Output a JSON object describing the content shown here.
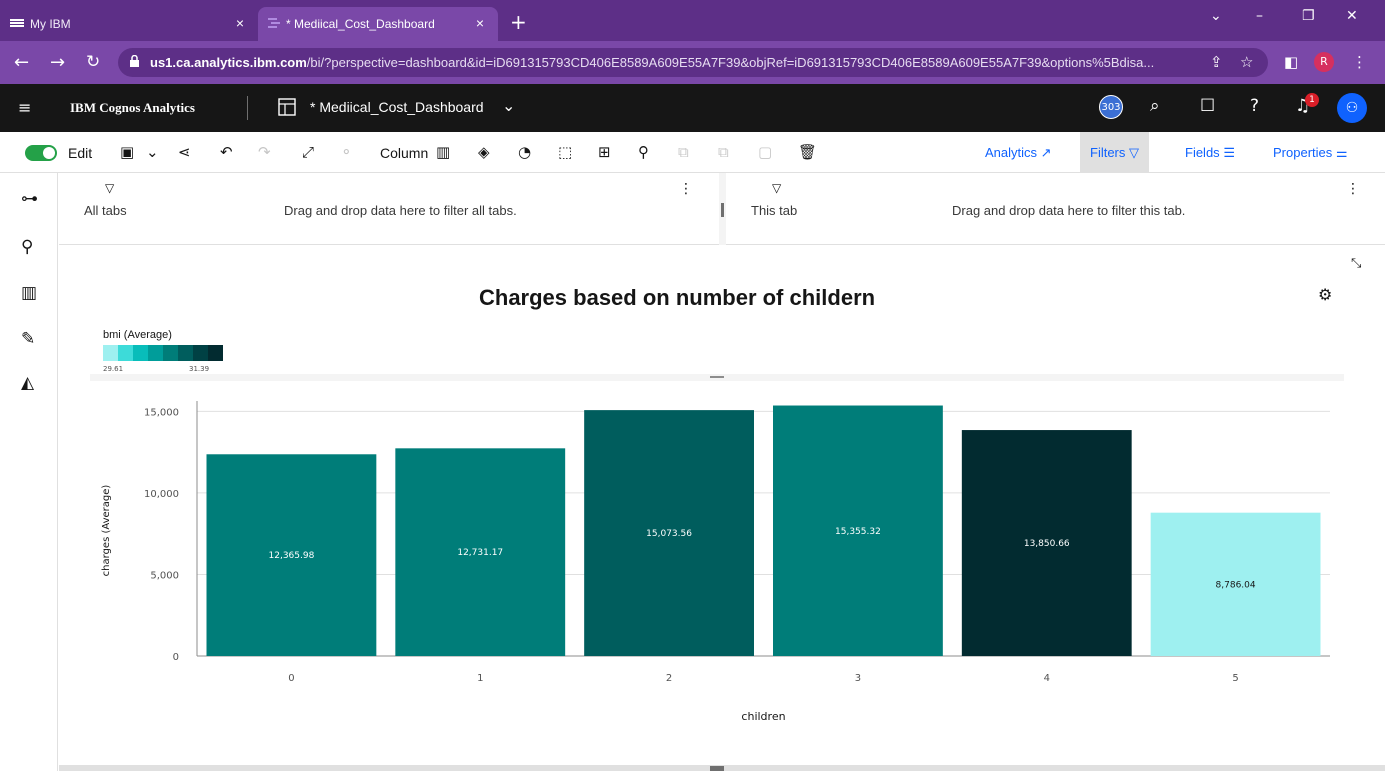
{
  "browser": {
    "tabs": [
      {
        "label": "My IBM",
        "close": "×"
      },
      {
        "label": "* Mediical_Cost_Dashboard",
        "close": "×"
      }
    ],
    "new_tab": "+",
    "url_host": "us1.ca.analytics.ibm.com",
    "url_path": "/bi/?perspective=dashboard&id=iD691315793CD406E8589A609E55A7F39&objRef=iD691315793CD406E8589A609E55A7F39&options%5Bdisa...",
    "profile_initial": "R"
  },
  "app": {
    "name": "IBM Cognos Analytics",
    "dashboard_title": "* Mediical_Cost_Dashboard",
    "count_badge": "303",
    "notification_count": "1"
  },
  "toolbar": {
    "edit_label": "Edit",
    "column_label": "Column",
    "panel_tabs": [
      {
        "label": "Analytics",
        "active": false
      },
      {
        "label": "Filters",
        "active": true
      },
      {
        "label": "Fields",
        "active": false
      },
      {
        "label": "Properties",
        "active": false
      }
    ]
  },
  "filters": {
    "all_tabs_label": "All tabs",
    "all_tabs_hint": "Drag and drop data here to filter all tabs.",
    "this_tab_label": "This tab",
    "this_tab_hint": "Drag and drop data here to filter this tab."
  },
  "legend": {
    "title": "bmi (Average)",
    "min": "29.61",
    "max": "31.39",
    "colors": [
      "#9ef0f0",
      "#3ddbd9",
      "#08bdba",
      "#009d9a",
      "#007d79",
      "#005d5d",
      "#004144",
      "#022b30"
    ]
  },
  "chart_data": {
    "type": "bar",
    "title": "Charges based on number of childern",
    "xlabel": "children",
    "ylabel": "charges (Average)",
    "categories": [
      "0",
      "1",
      "2",
      "3",
      "4",
      "5"
    ],
    "values": [
      12365.98,
      12731.17,
      15073.56,
      15355.32,
      13850.66,
      8786.04
    ],
    "value_labels": [
      "12,365.98",
      "12,731.17",
      "15,073.56",
      "15,355.32",
      "13,850.66",
      "8,786.04"
    ],
    "bar_colors": [
      "#007d79",
      "#007d79",
      "#005d5d",
      "#007d79",
      "#022b30",
      "#9ef0f0"
    ],
    "label_colors": [
      "#ffffff",
      "#ffffff",
      "#ffffff",
      "#ffffff",
      "#ffffff",
      "#161616"
    ],
    "ylim": [
      0,
      16000
    ],
    "yticks": [
      0,
      5000,
      10000,
      15000
    ],
    "ytick_labels": [
      "0",
      "5,000",
      "10,000",
      "15,000"
    ],
    "grid": true
  }
}
